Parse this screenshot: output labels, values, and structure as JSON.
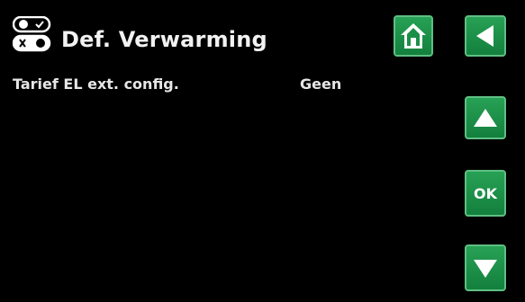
{
  "header": {
    "title": "Def. Verwarming",
    "icon": "toggle-switches-icon"
  },
  "rows": [
    {
      "label": "Tarief EL ext. config.",
      "value": "Geen"
    }
  ],
  "buttons": {
    "home_icon": "home-icon",
    "back_icon": "arrow-left-icon",
    "up_icon": "arrow-up-icon",
    "ok_label": "OK",
    "down_icon": "arrow-down-icon"
  },
  "colors": {
    "background": "#000000",
    "button_green": "#1b8f47",
    "text": "#f0f0f0"
  }
}
